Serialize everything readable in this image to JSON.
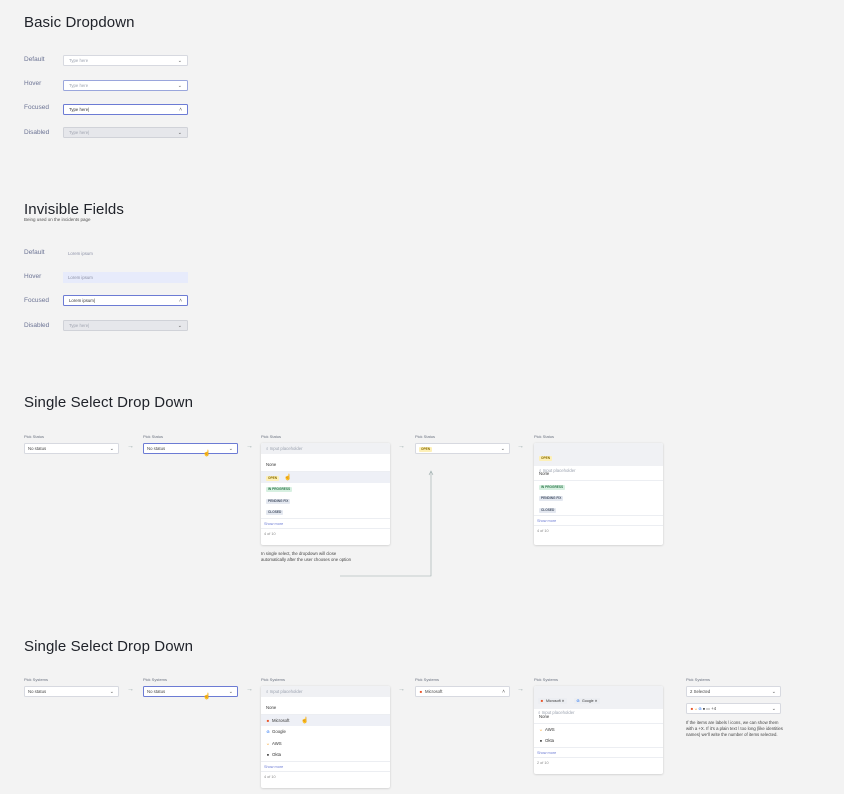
{
  "colors": {
    "accent": "#6c7bd4",
    "open_tag_bg": "#fdf0b8",
    "open_tag_fg": "#8a6d00",
    "progress_tag_bg": "#d7f0e1",
    "progress_tag_fg": "#2f7a4c",
    "pending_tag_bg": "#e4e8f0",
    "pending_tag_fg": "#4a5568",
    "closed_tag_bg": "#e4e8f0",
    "closed_tag_fg": "#4a5568"
  },
  "basic": {
    "title": "Basic Dropdown",
    "rows": [
      {
        "label": "Default",
        "value": "Type here"
      },
      {
        "label": "Hover",
        "value": "Type here"
      },
      {
        "label": "Focused",
        "value": "Type here|"
      },
      {
        "label": "Disabled",
        "value": "Type here|"
      }
    ]
  },
  "invisible": {
    "title": "Invisible Fields",
    "subtitle": "Being used on the incidents page",
    "rows": [
      {
        "label": "Default",
        "value": "Lorem ipsum"
      },
      {
        "label": "Hover",
        "value": "Lorem ipsum"
      },
      {
        "label": "Focused",
        "value": "Lorem ipsum|"
      },
      {
        "label": "Disabled",
        "value": "Type here|"
      }
    ]
  },
  "status": {
    "title": "Single Select Drop Down",
    "label": "Pick Status",
    "no_status": "No status",
    "search_placeholder": "Input placeholder",
    "none": "None",
    "options": [
      "OPEN",
      "IN PROGRESS",
      "PENDING FIX",
      "CLOSED"
    ],
    "show_more": "Show more",
    "count": "4 of 10",
    "note": "In single select, the dropdown will close automatically after the user chooses one option",
    "selected": "OPEN"
  },
  "systems": {
    "title": "Single Select Drop Down",
    "label": "Pick Systems",
    "no_status": "No status",
    "search_placeholder": "Input placeholder",
    "none": "None",
    "options": [
      "Microsoft",
      "Google",
      "AWS",
      "Okta"
    ],
    "show_more": "Show more",
    "count": "4 of 10",
    "selected": "Microsoft",
    "chips": [
      "Microsoft",
      "Google"
    ],
    "remaining": [
      "AWS",
      "Okta"
    ],
    "count2": "2 of 10",
    "selected_count": "2 Selected",
    "icons_more": "+4",
    "note": "If the items are labels \\ icons, we can show them with a +X. If it's a plain text \\ too long (like identities names) we'll write the number of items selected."
  }
}
